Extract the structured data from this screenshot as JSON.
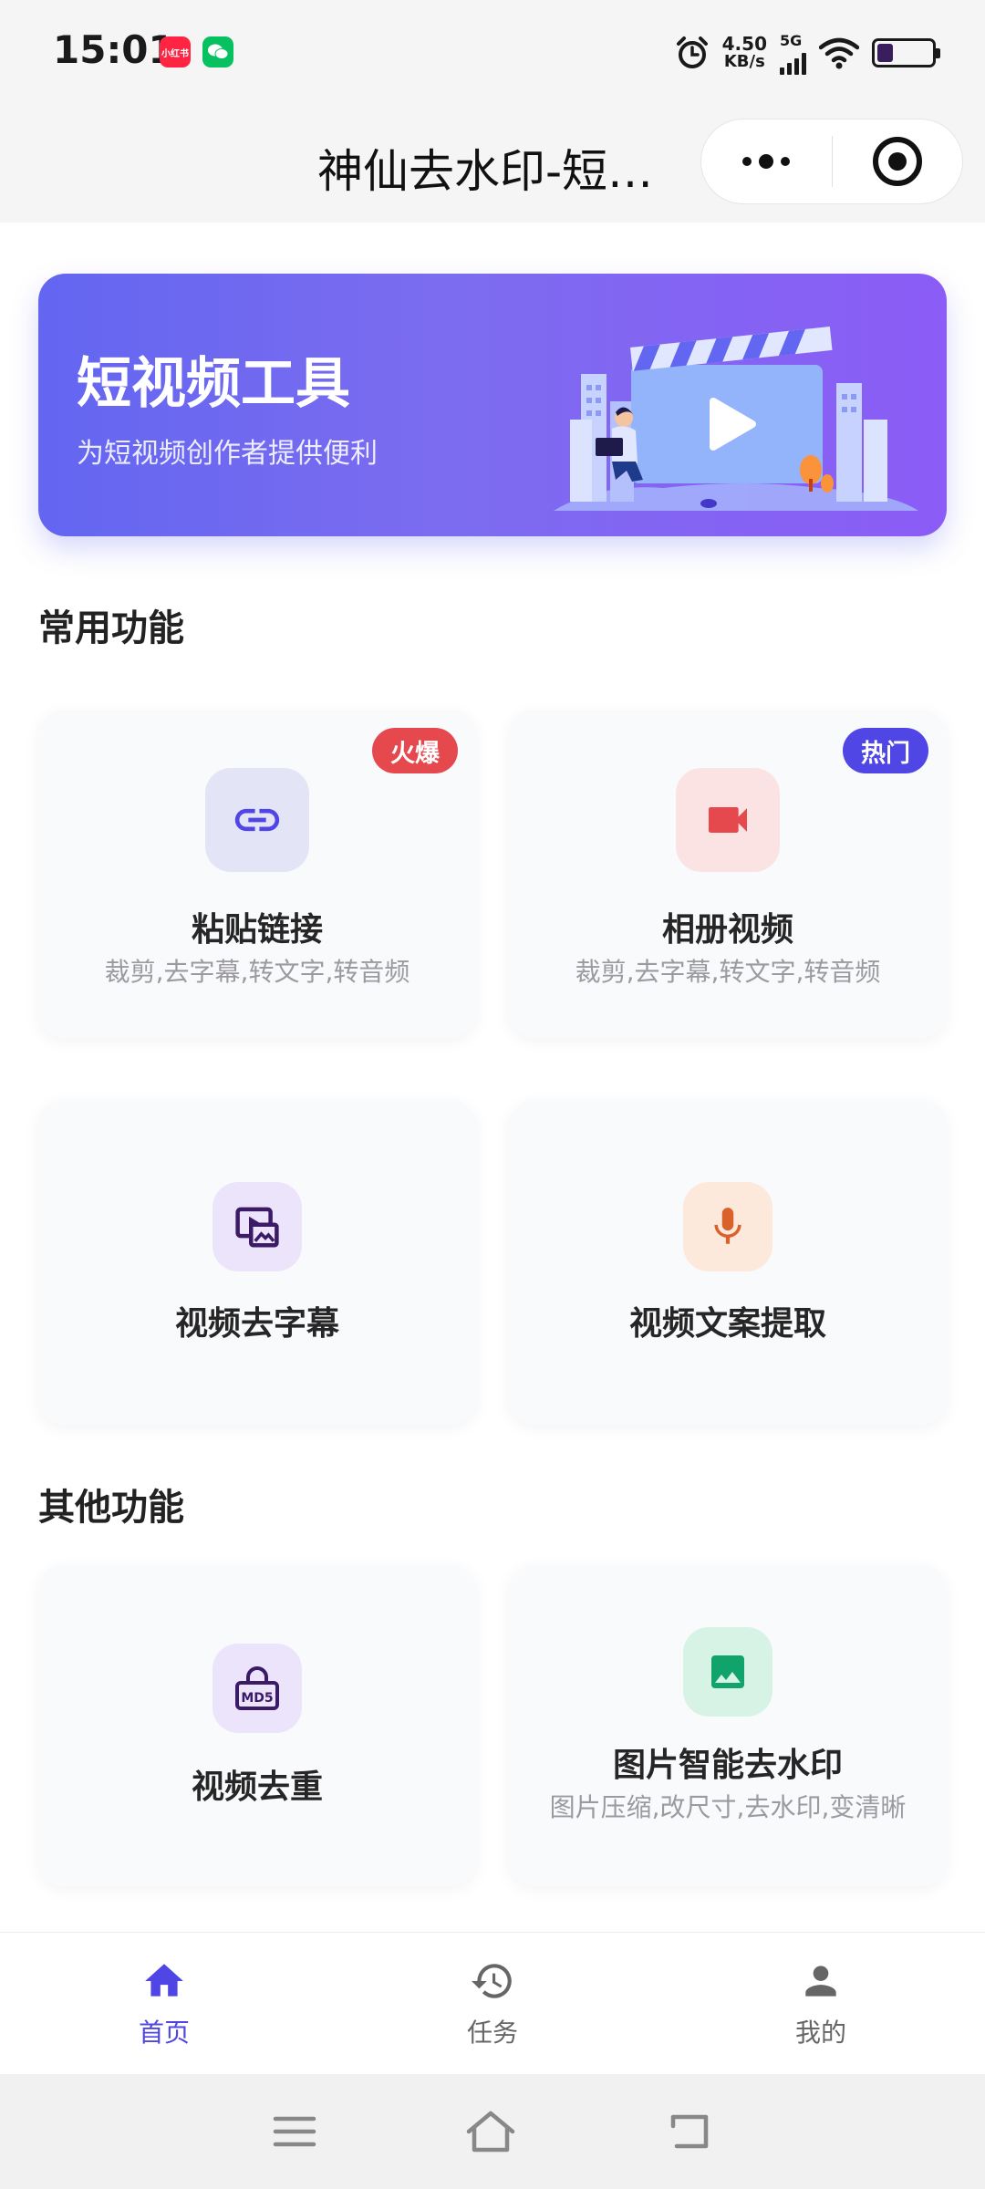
{
  "status_bar": {
    "time": "15:01",
    "app_badges": [
      "小红书",
      ""
    ],
    "speed_value": "4.50",
    "speed_unit": "KB/s",
    "network": "5G"
  },
  "header": {
    "title": "神仙去水印-短…"
  },
  "banner": {
    "title": "短视频工具",
    "subtitle": "为短视频创作者提供便利"
  },
  "sections": {
    "common": {
      "title": "常用功能",
      "cards": [
        {
          "title": "粘贴链接",
          "subtitle": "裁剪,去字幕,转文字,转音频",
          "tag": "火爆",
          "icon": "link-icon"
        },
        {
          "title": "相册视频",
          "subtitle": "裁剪,去字幕,转文字,转音频",
          "tag": "热门",
          "icon": "video-camera-icon"
        },
        {
          "title": "视频去字幕",
          "icon": "subtitle-remove-icon"
        },
        {
          "title": "视频文案提取",
          "icon": "microphone-icon"
        }
      ]
    },
    "other": {
      "title": "其他功能",
      "cards": [
        {
          "title": "视频去重",
          "icon": "md5-lock-icon",
          "icon_text": "MD5"
        },
        {
          "title": "图片智能去水印",
          "subtitle": "图片压缩,改尺寸,去水印,变清晰",
          "icon": "image-icon"
        }
      ]
    }
  },
  "tab_bar": {
    "items": [
      {
        "label": "首页",
        "icon": "home-icon",
        "active": true
      },
      {
        "label": "任务",
        "icon": "history-icon",
        "active": false
      },
      {
        "label": "我的",
        "icon": "user-icon",
        "active": false
      }
    ]
  },
  "colors": {
    "accent": "#4f46e5",
    "tag_hot": "#e5484d",
    "tag_popular": "#4f46e5",
    "banner_start": "#6366f1",
    "banner_end": "#8b5cf6"
  }
}
